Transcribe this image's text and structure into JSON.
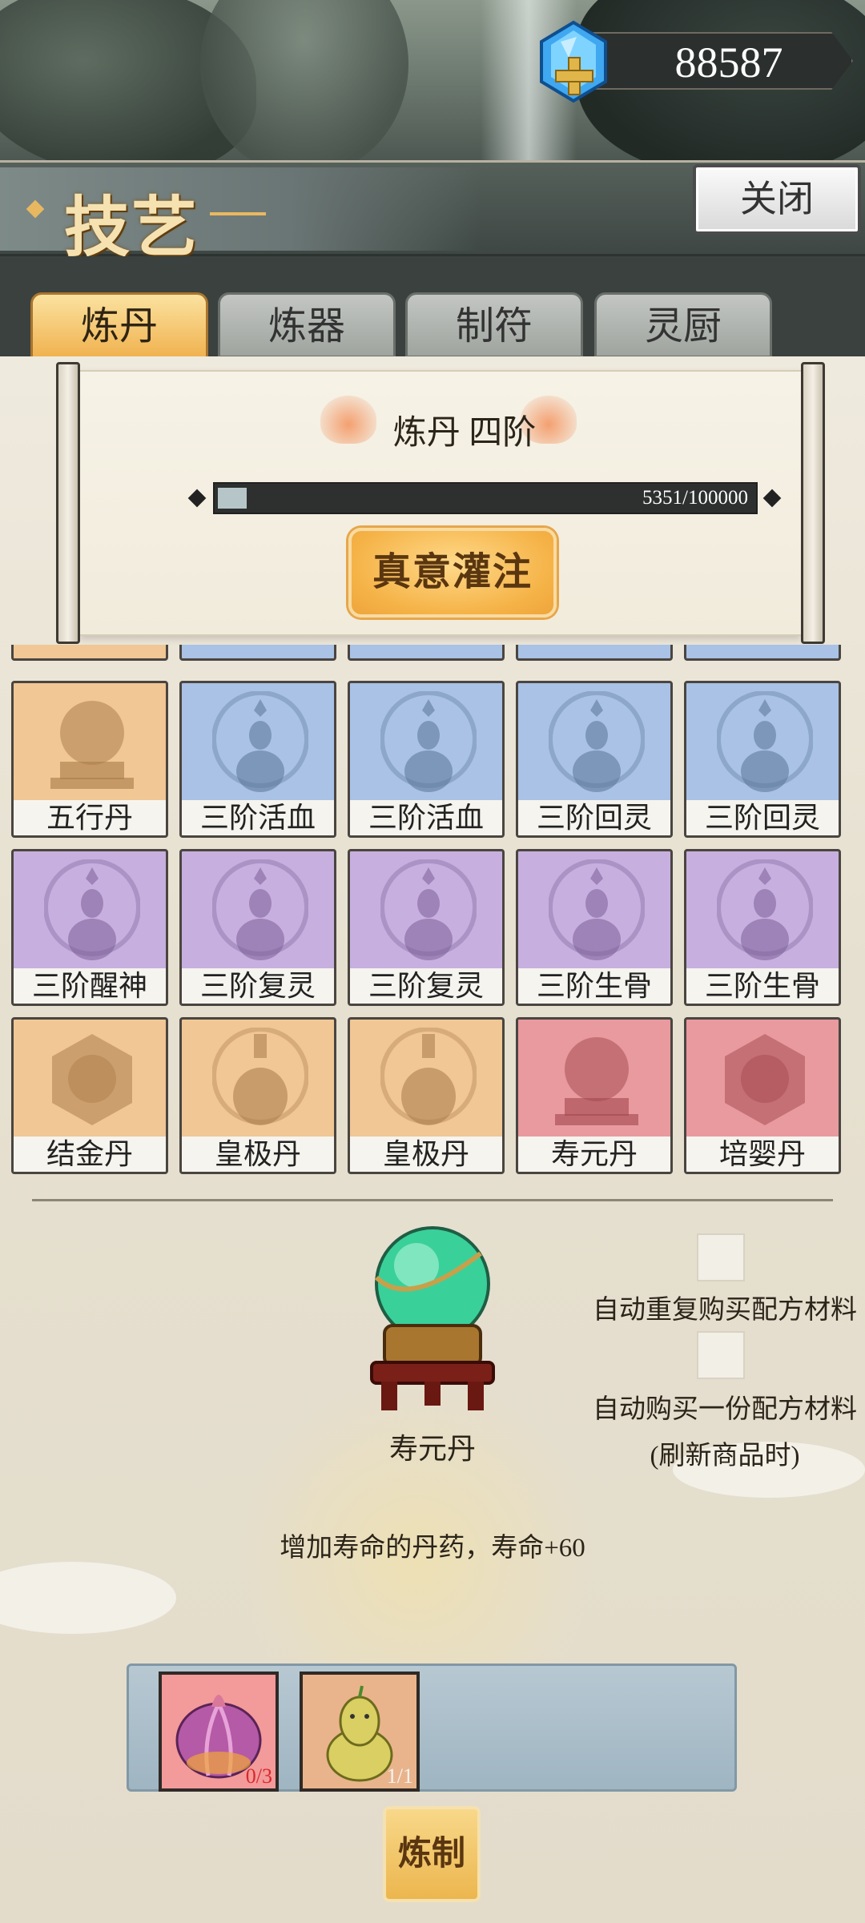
{
  "currency": {
    "value": "88587",
    "icon": "blue-gem-plus-icon"
  },
  "header": {
    "title": "技艺",
    "close_label": "关闭"
  },
  "tabs": [
    {
      "label": "炼丹",
      "active": true
    },
    {
      "label": "炼器",
      "active": false
    },
    {
      "label": "制符",
      "active": false
    },
    {
      "label": "灵厨",
      "active": false
    }
  ],
  "level": {
    "title": "炼丹 四阶",
    "progress_text": "5351/100000",
    "progress_fraction": 0.05351,
    "infuse_label": "真意灌注"
  },
  "grid": {
    "rows": [
      [
        {
          "label": "五行丹",
          "color": "orange",
          "icon": "crystal-ball-icon"
        },
        {
          "label": "三阶活血",
          "color": "blue",
          "icon": "gourd-vase-icon"
        },
        {
          "label": "三阶活血",
          "color": "blue",
          "icon": "gourd-vase-icon"
        },
        {
          "label": "三阶回灵",
          "color": "blue",
          "icon": "gourd-vase-icon"
        },
        {
          "label": "三阶回灵",
          "color": "blue",
          "icon": "gourd-vase-icon"
        }
      ],
      [
        {
          "label": "三阶醒神",
          "color": "purple",
          "icon": "gourd-vase-icon"
        },
        {
          "label": "三阶复灵",
          "color": "purple",
          "icon": "gourd-vase-icon"
        },
        {
          "label": "三阶复灵",
          "color": "purple",
          "icon": "gourd-vase-icon"
        },
        {
          "label": "三阶生骨",
          "color": "purple",
          "icon": "gourd-vase-icon"
        },
        {
          "label": "三阶生骨",
          "color": "purple",
          "icon": "gourd-vase-icon"
        }
      ],
      [
        {
          "label": "结金丹",
          "color": "orange",
          "icon": "hexagon-pill-icon"
        },
        {
          "label": "皇极丹",
          "color": "orange",
          "icon": "porcelain-vase-icon"
        },
        {
          "label": "皇极丹",
          "color": "orange",
          "icon": "porcelain-vase-icon"
        },
        {
          "label": "寿元丹",
          "color": "red",
          "icon": "crystal-ball-icon"
        },
        {
          "label": "培婴丹",
          "color": "red",
          "icon": "hexagon-pill-icon"
        }
      ]
    ]
  },
  "detail": {
    "name": "寿元丹",
    "description": "增加寿命的丹药，寿命+60",
    "icon": "green-orb-on-stand-icon"
  },
  "options": {
    "auto_repeat_label": "自动重复购买配方材料",
    "auto_once_label": "自动购买一份配方材料",
    "auto_once_sub": "(刷新商品时)"
  },
  "materials": [
    {
      "count": "0/3",
      "color": "#d8282a",
      "icon": "garlic-bulb-icon"
    },
    {
      "count": "1/1",
      "color": "#f4f4f4",
      "icon": "pear-fruit-icon"
    }
  ],
  "refine_label": "炼制"
}
